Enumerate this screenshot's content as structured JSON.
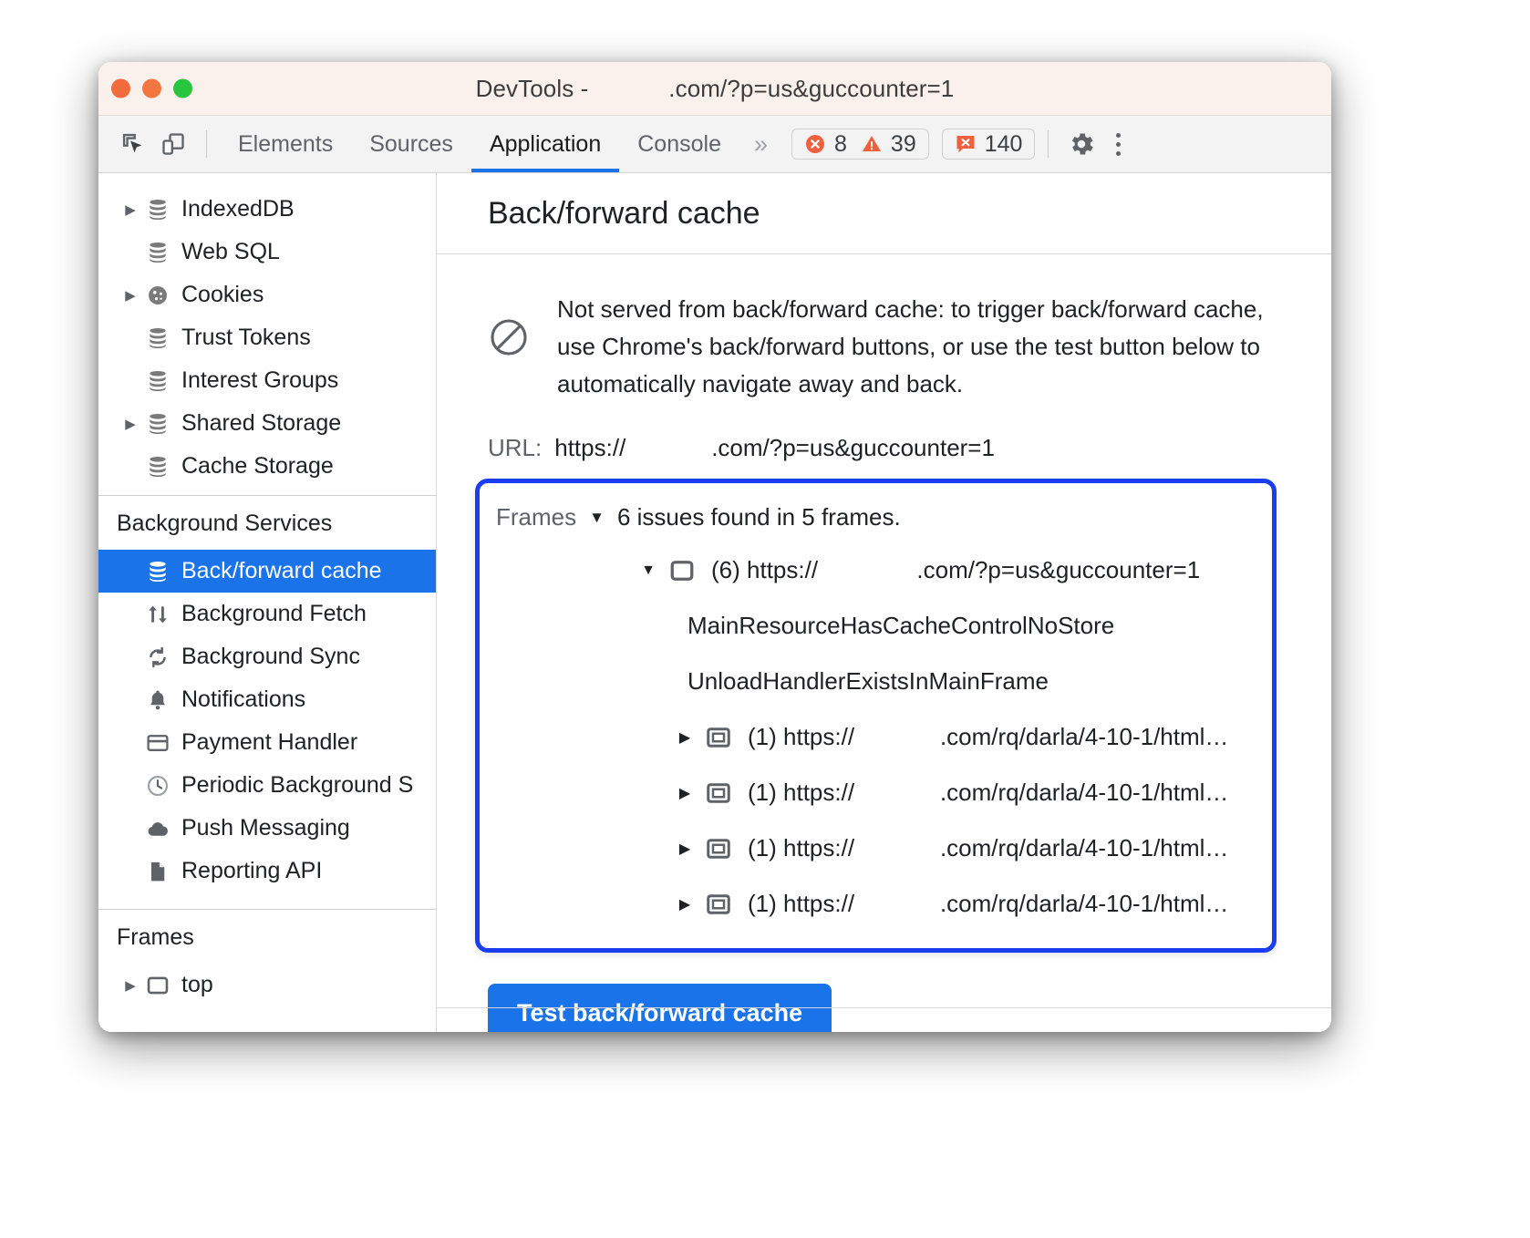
{
  "window": {
    "title": "DevTools -            .com/?p=us&guccounter=1",
    "traffic_lights": [
      "close",
      "minimize",
      "maximize"
    ]
  },
  "toolbar": {
    "inspect_icon": "inspect-element-icon",
    "device_icon": "device-toolbar-icon",
    "tabs": [
      {
        "label": "Elements",
        "active": false
      },
      {
        "label": "Sources",
        "active": false
      },
      {
        "label": "Application",
        "active": true
      },
      {
        "label": "Console",
        "active": false
      }
    ],
    "more_tabs": "»",
    "error_count": "8",
    "warning_count": "39",
    "issue_count": "140",
    "settings_icon": "gear-icon",
    "menu_icon": "kebab-menu-icon",
    "accent": "#1a73e8",
    "error_color": "#f0603c"
  },
  "sidebar": {
    "storage_items": [
      {
        "label": "IndexedDB",
        "icon": "database-icon",
        "expandable": true
      },
      {
        "label": "Web SQL",
        "icon": "database-icon",
        "expandable": false
      },
      {
        "label": "Cookies",
        "icon": "cookie-icon",
        "expandable": true
      },
      {
        "label": "Trust Tokens",
        "icon": "database-icon",
        "expandable": false
      },
      {
        "label": "Interest Groups",
        "icon": "database-icon",
        "expandable": false
      },
      {
        "label": "Shared Storage",
        "icon": "database-icon",
        "expandable": true
      },
      {
        "label": "Cache Storage",
        "icon": "database-icon",
        "expandable": false
      }
    ],
    "background_services_title": "Background Services",
    "background_services": [
      {
        "label": "Back/forward cache",
        "icon": "database-icon",
        "selected": true
      },
      {
        "label": "Background Fetch",
        "icon": "up-down-arrows-icon",
        "selected": false
      },
      {
        "label": "Background Sync",
        "icon": "sync-icon",
        "selected": false
      },
      {
        "label": "Notifications",
        "icon": "bell-icon",
        "selected": false
      },
      {
        "label": "Payment Handler",
        "icon": "credit-card-icon",
        "selected": false
      },
      {
        "label": "Periodic Background S",
        "icon": "clock-icon",
        "selected": false
      },
      {
        "label": "Push Messaging",
        "icon": "cloud-icon",
        "selected": false
      },
      {
        "label": "Reporting API",
        "icon": "document-icon",
        "selected": false
      }
    ],
    "frames_title": "Frames",
    "frames_items": [
      {
        "label": "top",
        "icon": "frame-icon",
        "expandable": true
      }
    ],
    "selected_color": "#1a73e8"
  },
  "main": {
    "panel_title": "Back/forward cache",
    "status_icon": "blocked-circle-slash-icon",
    "status_message": "Not served from back/forward cache: to trigger back/forward cache, use Chrome's back/forward buttons, or use the test button below to automatically navigate away and back.",
    "url_label": "URL:",
    "url_value": "https://             .com/?p=us&guccounter=1",
    "frames": {
      "label": "Frames",
      "caret": "▼",
      "summary": "6 issues found in 5 frames.",
      "highlight_color": "#1a3df0",
      "rows": [
        {
          "type": "frame",
          "expanded": true,
          "arrow": "▼",
          "icon": "frame-icon",
          "count": "(6)",
          "url": "https://               .com/?p=us&guccounter=1",
          "level": 1
        },
        {
          "type": "reason",
          "text": "MainResourceHasCacheControlNoStore"
        },
        {
          "type": "reason",
          "text": "UnloadHandlerExistsInMainFrame"
        },
        {
          "type": "frame",
          "expanded": false,
          "arrow": "▶",
          "icon": "iframe-icon",
          "count": "(1)",
          "url": "https://             .com/rq/darla/4-10-1/html…",
          "level": 2
        },
        {
          "type": "frame",
          "expanded": false,
          "arrow": "▶",
          "icon": "iframe-icon",
          "count": "(1)",
          "url": "https://             .com/rq/darla/4-10-1/html…",
          "level": 2
        },
        {
          "type": "frame",
          "expanded": false,
          "arrow": "▶",
          "icon": "iframe-icon",
          "count": "(1)",
          "url": "https://             .com/rq/darla/4-10-1/html…",
          "level": 2
        },
        {
          "type": "frame",
          "expanded": false,
          "arrow": "▶",
          "icon": "iframe-icon",
          "count": "(1)",
          "url": "https://             .com/rq/darla/4-10-1/html…",
          "level": 2
        }
      ]
    },
    "test_button_label": "Test back/forward cache"
  }
}
